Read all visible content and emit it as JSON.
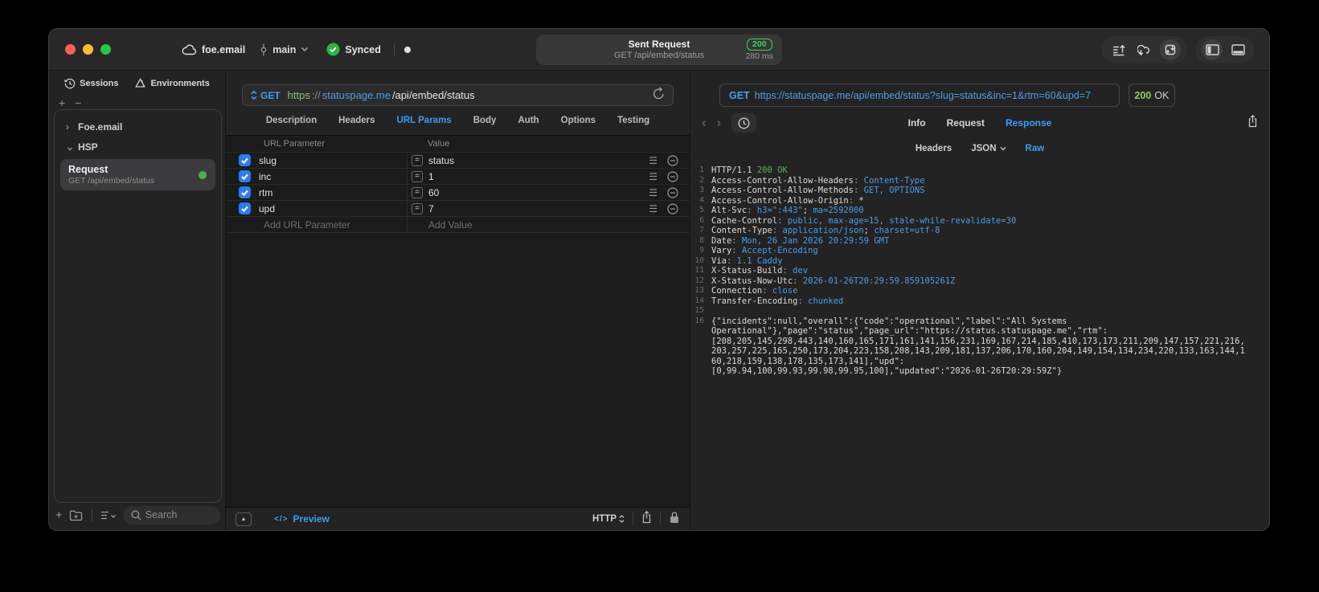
{
  "colors": {
    "accent_blue": "#3f9bf5",
    "link_blue": "#4a9de8",
    "green_badge": "#3fd158",
    "green_ok": "#8fcf61",
    "checkbox_blue": "#2a7bf6",
    "status_dot_green": "#4caf50"
  },
  "titlebar": {
    "project": "foe.email",
    "branch": "main",
    "sync_status": "Synced",
    "center": {
      "title": "Sent Request",
      "subtitle": "GET /api/embed/status",
      "status_code": "200",
      "duration": "280 ms"
    }
  },
  "sidebar": {
    "tabs": [
      {
        "label": "Sessions"
      },
      {
        "label": "Environments"
      }
    ],
    "add_label": "+",
    "remove_label": "−",
    "tree": [
      {
        "chevron": "›",
        "label": "Foe.email"
      },
      {
        "chevron": "⌄",
        "label": "HSP"
      }
    ],
    "request_item": {
      "title": "Request",
      "subtitle": "GET /api/embed/status"
    },
    "search_placeholder": "Search"
  },
  "request_pane": {
    "method": "GET",
    "url": {
      "scheme": "https",
      "separator": "://",
      "host": "statuspage.me",
      "path": "/api/embed/status"
    },
    "tabs": [
      "Description",
      "Headers",
      "URL Params",
      "Body",
      "Auth",
      "Options",
      "Testing"
    ],
    "active_tab": "URL Params",
    "param_table": {
      "columns": [
        "URL Parameter",
        "Value"
      ],
      "rows": [
        {
          "name": "slug",
          "value": "status",
          "enabled": true
        },
        {
          "name": "inc",
          "value": "1",
          "enabled": true
        },
        {
          "name": "rtm",
          "value": "60",
          "enabled": true
        },
        {
          "name": "upd",
          "value": "7",
          "enabled": true
        }
      ],
      "add_name_placeholder": "Add URL Parameter",
      "add_value_placeholder": "Add Value"
    },
    "footer": {
      "collapse_glyph": "▲",
      "code_glyph": "</>",
      "preview_label": "Preview",
      "http_label": "HTTP"
    }
  },
  "response_pane": {
    "request_line_method": "GET",
    "request_line_url": "https://statuspage.me/api/embed/status?slug=status&inc=1&rtm=60&upd=7",
    "status_code": "200",
    "status_text": "OK",
    "nav": {
      "back": "‹",
      "forward": "›"
    },
    "tabs": [
      "Info",
      "Request",
      "Response"
    ],
    "active_tab": "Response",
    "subtabs": [
      {
        "label": "Headers"
      },
      {
        "label": "JSON",
        "chevron": true
      },
      {
        "label": "Raw"
      }
    ],
    "active_subtab": "Raw",
    "lines": [
      {
        "n": "1",
        "parts": [
          [
            "cw",
            "HTTP/1.1 "
          ],
          [
            "cg",
            "200 OK"
          ]
        ]
      },
      {
        "n": "2",
        "parts": [
          [
            "cw",
            "Access-Control-Allow-Headers"
          ],
          [
            "cd",
            ": "
          ],
          [
            "cb2",
            "Content-Type"
          ]
        ]
      },
      {
        "n": "3",
        "parts": [
          [
            "cw",
            "Access-Control-Allow-Methods"
          ],
          [
            "cd",
            ": "
          ],
          [
            "cb2",
            "GET, OPTIONS"
          ]
        ]
      },
      {
        "n": "4",
        "parts": [
          [
            "cw",
            "Access-Control-Allow-Origin"
          ],
          [
            "cd",
            ": "
          ],
          [
            "cw",
            "*"
          ]
        ]
      },
      {
        "n": "5",
        "parts": [
          [
            "cw",
            "Alt-Svc"
          ],
          [
            "cd",
            ": "
          ],
          [
            "cb2",
            "h3=\":443\""
          ],
          [
            "cw",
            "; "
          ],
          [
            "cb2",
            "ma=2592000"
          ]
        ]
      },
      {
        "n": "6",
        "parts": [
          [
            "cw",
            "Cache-Control"
          ],
          [
            "cd",
            ": "
          ],
          [
            "cb2",
            "public, max-age=15, stale-while-revalidate=30"
          ]
        ]
      },
      {
        "n": "7",
        "parts": [
          [
            "cw",
            "Content-Type"
          ],
          [
            "cd",
            ": "
          ],
          [
            "cb2",
            "application/json"
          ],
          [
            "cw",
            "; "
          ],
          [
            "cb2",
            "charset=utf-8"
          ]
        ]
      },
      {
        "n": "8",
        "parts": [
          [
            "cw",
            "Date"
          ],
          [
            "cd",
            ": "
          ],
          [
            "cb2",
            "Mon, 26 Jan 2026 20:29:59 GMT"
          ]
        ]
      },
      {
        "n": "9",
        "parts": [
          [
            "cw",
            "Vary"
          ],
          [
            "cd",
            ": "
          ],
          [
            "cb2",
            "Accept-Encoding"
          ]
        ]
      },
      {
        "n": "10",
        "parts": [
          [
            "cw",
            "Via"
          ],
          [
            "cd",
            ": "
          ],
          [
            "cb2",
            "1.1 Caddy"
          ]
        ]
      },
      {
        "n": "11",
        "parts": [
          [
            "cw",
            "X-Status-Build"
          ],
          [
            "cd",
            ": "
          ],
          [
            "cb2",
            "dev"
          ]
        ]
      },
      {
        "n": "12",
        "parts": [
          [
            "cw",
            "X-Status-Now-Utc"
          ],
          [
            "cd",
            ": "
          ],
          [
            "cb2",
            "2026-01-26T20:29:59.859105261Z"
          ]
        ]
      },
      {
        "n": "13",
        "parts": [
          [
            "cw",
            "Connection"
          ],
          [
            "cd",
            ": "
          ],
          [
            "cb2",
            "close"
          ]
        ]
      },
      {
        "n": "14",
        "parts": [
          [
            "cw",
            "Transfer-Encoding"
          ],
          [
            "cd",
            ": "
          ],
          [
            "cb2",
            "chunked"
          ]
        ]
      },
      {
        "n": "15",
        "parts": []
      },
      {
        "n": "16",
        "parts": [
          [
            "cw",
            "{\"incidents\":null,\"overall\":{\"code\":\"operational\",\"label\":\"All Systems"
          ]
        ]
      },
      {
        "n": "",
        "parts": [
          [
            "cw",
            "Operational\"},\"page\":\"status\",\"page_url\":\"https://status.statuspage.me\",\"rtm\":"
          ]
        ]
      },
      {
        "n": "",
        "parts": [
          [
            "cw",
            "[208,205,145,298,443,140,160,165,171,161,141,156,231,169,167,214,185,410,173,173,211,209,147,157,221,216,"
          ]
        ]
      },
      {
        "n": "",
        "parts": [
          [
            "cw",
            "203,257,225,165,250,173,204,223,158,208,143,209,181,137,206,170,160,204,149,154,134,234,220,133,163,144,1"
          ]
        ]
      },
      {
        "n": "",
        "parts": [
          [
            "cw",
            "60,218,159,138,178,135,173,141],\"upd\":"
          ]
        ]
      },
      {
        "n": "",
        "parts": [
          [
            "cw",
            "[0,99.94,100,99.93,99.98,99.95,100],\"updated\":\"2026-01-26T20:29:59Z\"}"
          ]
        ]
      }
    ]
  }
}
